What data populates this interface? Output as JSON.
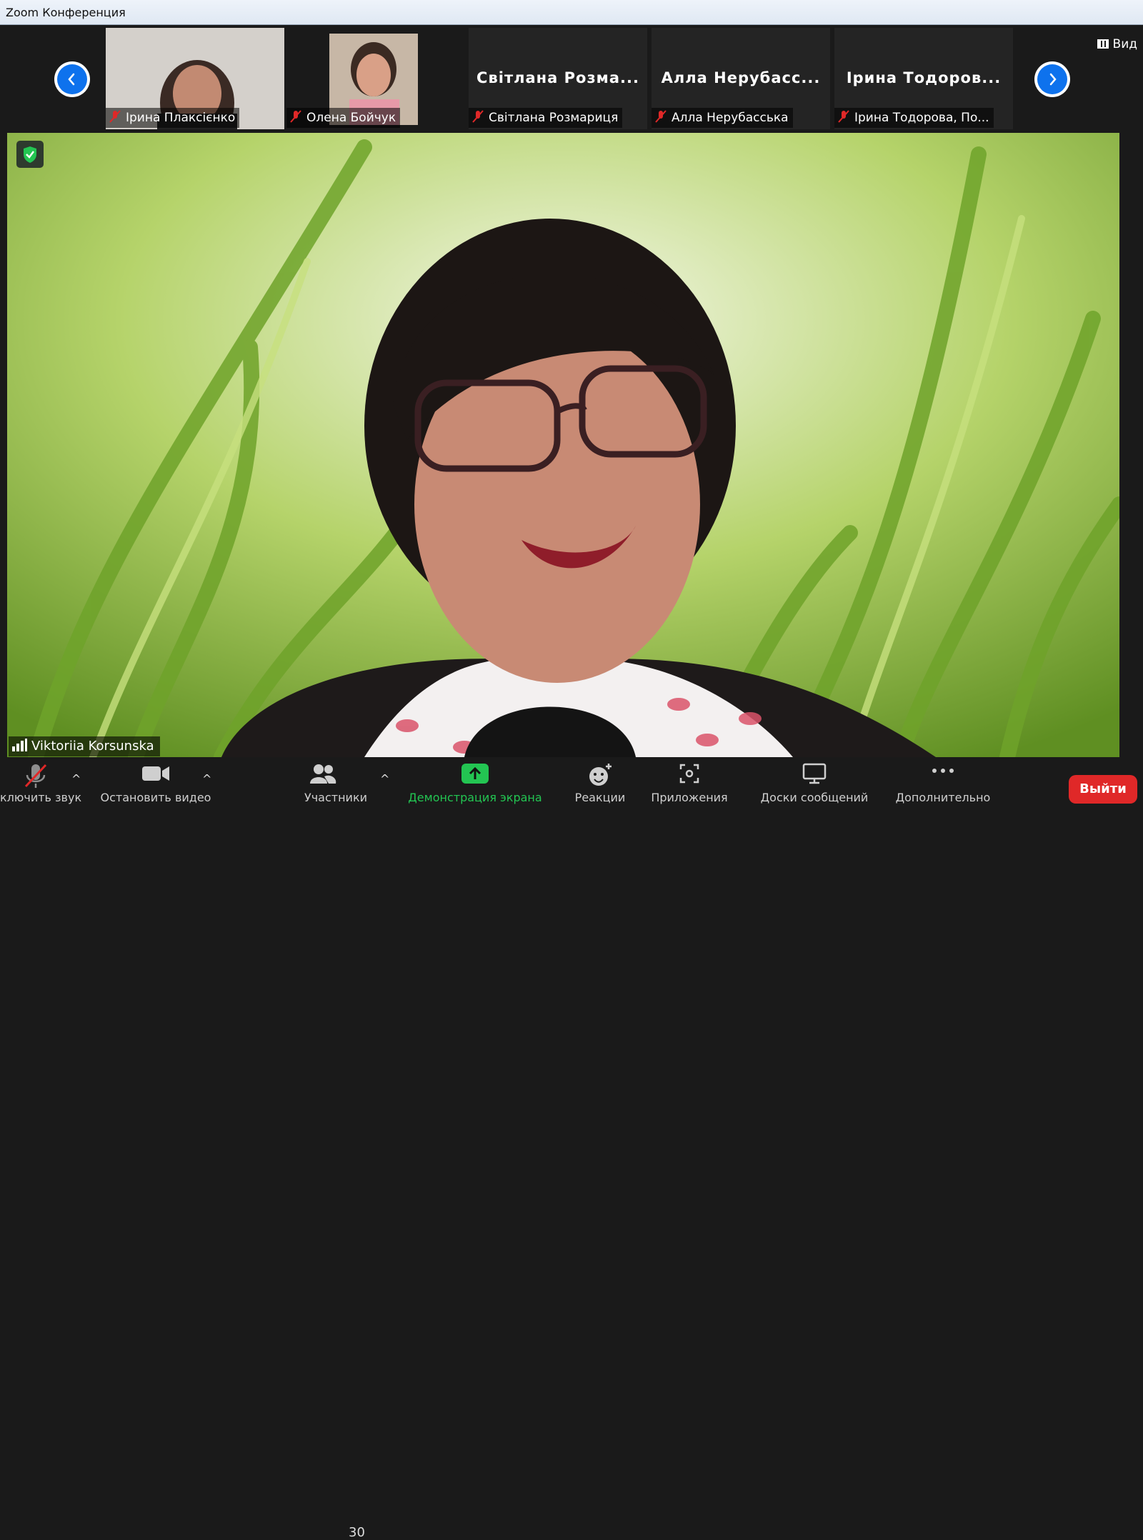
{
  "window": {
    "title": "Zoom Конференция"
  },
  "strip": {
    "view_label": "Вид",
    "tiles": [
      {
        "type": "video",
        "label": "Ірина Плаксієнко"
      },
      {
        "type": "video",
        "label": "Олена Бойчук"
      },
      {
        "type": "name",
        "display_name": "Світлана Розма...",
        "label": "Світлана Розмариця"
      },
      {
        "type": "name",
        "display_name": "Алла Нерубасс...",
        "label": "Алла Нерубасська"
      },
      {
        "type": "name",
        "display_name": "Ірина Тодоров...",
        "label": "Ірина Тодорова, По..."
      }
    ]
  },
  "main": {
    "speaker_name": "Viktoriia Korsunska"
  },
  "toolbar": {
    "mute_label": "ключить звук",
    "video_label": "Остановить видео",
    "participants_label": "Участники",
    "participants_count": "30",
    "share_label": "Демонстрация экрана",
    "reactions_label": "Реакции",
    "apps_label": "Приложения",
    "whiteboards_label": "Доски сообщений",
    "more_label": "Дополнительно",
    "leave_label": "Выйти"
  },
  "colors": {
    "accent": "#0e72ed",
    "share_green": "#23c552",
    "leave_red": "#e02828"
  }
}
